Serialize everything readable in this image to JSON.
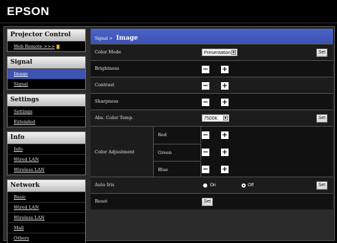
{
  "header": {
    "logo": "EPSON"
  },
  "sidebar": {
    "groups": [
      {
        "title": "Projector Control",
        "items": [
          {
            "label": "Web Remote >>>"
          }
        ]
      },
      {
        "title": "Signal",
        "items": [
          {
            "label": "Image",
            "active": true
          },
          {
            "label": "Signal"
          }
        ]
      },
      {
        "title": "Settings",
        "items": [
          {
            "label": "Settings"
          },
          {
            "label": "Extended"
          }
        ]
      },
      {
        "title": "Info",
        "items": [
          {
            "label": "Info"
          },
          {
            "label": "Wired LAN"
          },
          {
            "label": "Wireless LAN"
          }
        ]
      },
      {
        "title": "Network",
        "items": [
          {
            "label": "Basic"
          },
          {
            "label": "Wired LAN"
          },
          {
            "label": "Wireless LAN"
          },
          {
            "label": "Mail"
          },
          {
            "label": "Others"
          }
        ]
      }
    ]
  },
  "content": {
    "breadcrumb_parent": "Signal >",
    "title": "Image",
    "color_mode": {
      "label": "Color Mode",
      "value": "Presentation",
      "set": "Set"
    },
    "brightness": {
      "label": "Brightness"
    },
    "contrast": {
      "label": "Contrast"
    },
    "sharpness": {
      "label": "Sharpness"
    },
    "abs_color_temp": {
      "label": "Abs. Color Temp.",
      "value": "7500K",
      "set": "Set"
    },
    "color_adjustment": {
      "label": "Color Adjustment",
      "red": "Red",
      "green": "Green",
      "blue": "Blue"
    },
    "auto_iris": {
      "label": "Auto Iris",
      "on": "On",
      "off": "Off",
      "selected": "off",
      "set": "Set"
    },
    "reset": {
      "label": "Reset",
      "set": "Set"
    },
    "minus": "−",
    "plus": "+"
  }
}
